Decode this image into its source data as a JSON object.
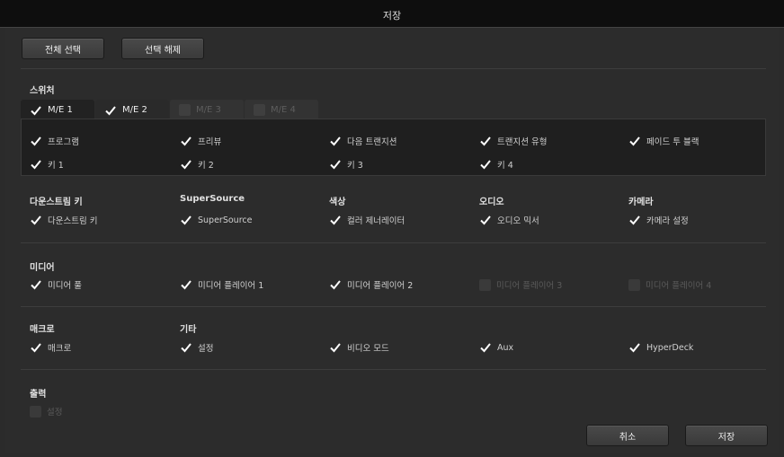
{
  "window": {
    "title": "저장"
  },
  "top_buttons": {
    "select_all": "전체 선택",
    "deselect": "선택 해제"
  },
  "switcher": {
    "heading": "스위처",
    "tabs": [
      {
        "label": "M/E 1",
        "checked": true
      },
      {
        "label": "M/E 2",
        "checked": true
      },
      {
        "label": "M/E 3",
        "checked": false
      },
      {
        "label": "M/E 4",
        "checked": false
      }
    ],
    "row1": [
      "프로그램",
      "프리뷰",
      "다음 트랜지션",
      "트랜지션 유형",
      "페이드 투 블랙"
    ],
    "row2": [
      "키 1",
      "키 2",
      "키 3",
      "키 4"
    ]
  },
  "groups1": [
    {
      "heading": "다운스트림 키",
      "item": "다운스트림 키"
    },
    {
      "heading": "SuperSource",
      "item": "SuperSource"
    },
    {
      "heading": "색상",
      "item": "컬러 제너레이터"
    },
    {
      "heading": "오디오",
      "item": "오디오 믹서"
    },
    {
      "heading": "카메라",
      "item": "카메라 설정"
    }
  ],
  "media": {
    "heading": "미디어",
    "items": [
      {
        "label": "미디어 풀",
        "checked": true
      },
      {
        "label": "미디어 플레이어 1",
        "checked": true
      },
      {
        "label": "미디어 플레이어 2",
        "checked": true
      },
      {
        "label": "미디어 플레이어 3",
        "checked": false
      },
      {
        "label": "미디어 플레이어 4",
        "checked": false
      }
    ]
  },
  "macro": {
    "heading": "매크로",
    "item": "매크로"
  },
  "other": {
    "heading": "기타",
    "items": [
      "설정",
      "비디오 모드",
      "Aux",
      "HyperDeck"
    ]
  },
  "output": {
    "heading": "출력",
    "item": "설정"
  },
  "footer": {
    "cancel": "취소",
    "save": "저장"
  }
}
